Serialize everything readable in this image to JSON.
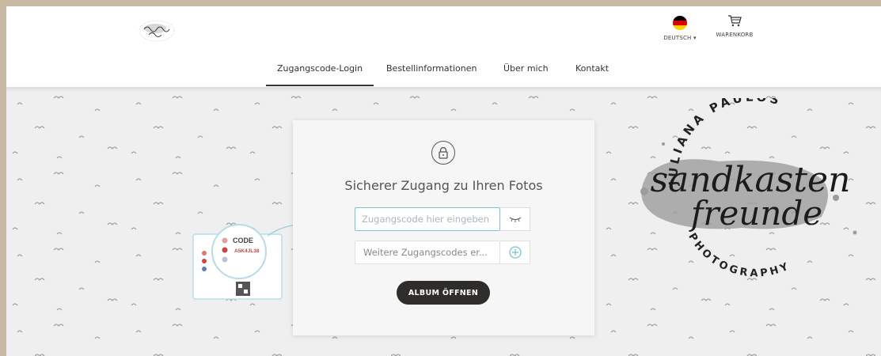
{
  "header": {
    "language": {
      "label": "DEUTSCH",
      "caret": "▾",
      "flag_colors": [
        "#000000",
        "#dd0000",
        "#ffce00"
      ]
    },
    "cart": {
      "label": "WARENKORB"
    }
  },
  "nav": {
    "items": [
      {
        "label": "Zugangscode-Login",
        "active": true
      },
      {
        "label": "Bestellinformationen",
        "active": false
      },
      {
        "label": "Über mich",
        "active": false
      },
      {
        "label": "Kontakt",
        "active": false
      }
    ]
  },
  "login": {
    "title": "Sicherer Zugang zu Ihren Fotos",
    "code_placeholder": "Zugangscode hier eingeben",
    "more_codes_placeholder": "Weitere Zugangscodes er...",
    "open_button": "ALBUM ÖFFNEN"
  },
  "illustration": {
    "code_label": "CODE",
    "code_value": "A5K4JL38"
  },
  "brand": {
    "arc_top": "JULIANA PAULOS",
    "script_line1": "sandkasten",
    "script_line2": "freunde",
    "arc_bottom": "PHOTOGRAPHY"
  },
  "colors": {
    "accent": "#7bc3d6",
    "button_dark": "#2e2d2a",
    "frame_border": "#c9b9a4"
  }
}
